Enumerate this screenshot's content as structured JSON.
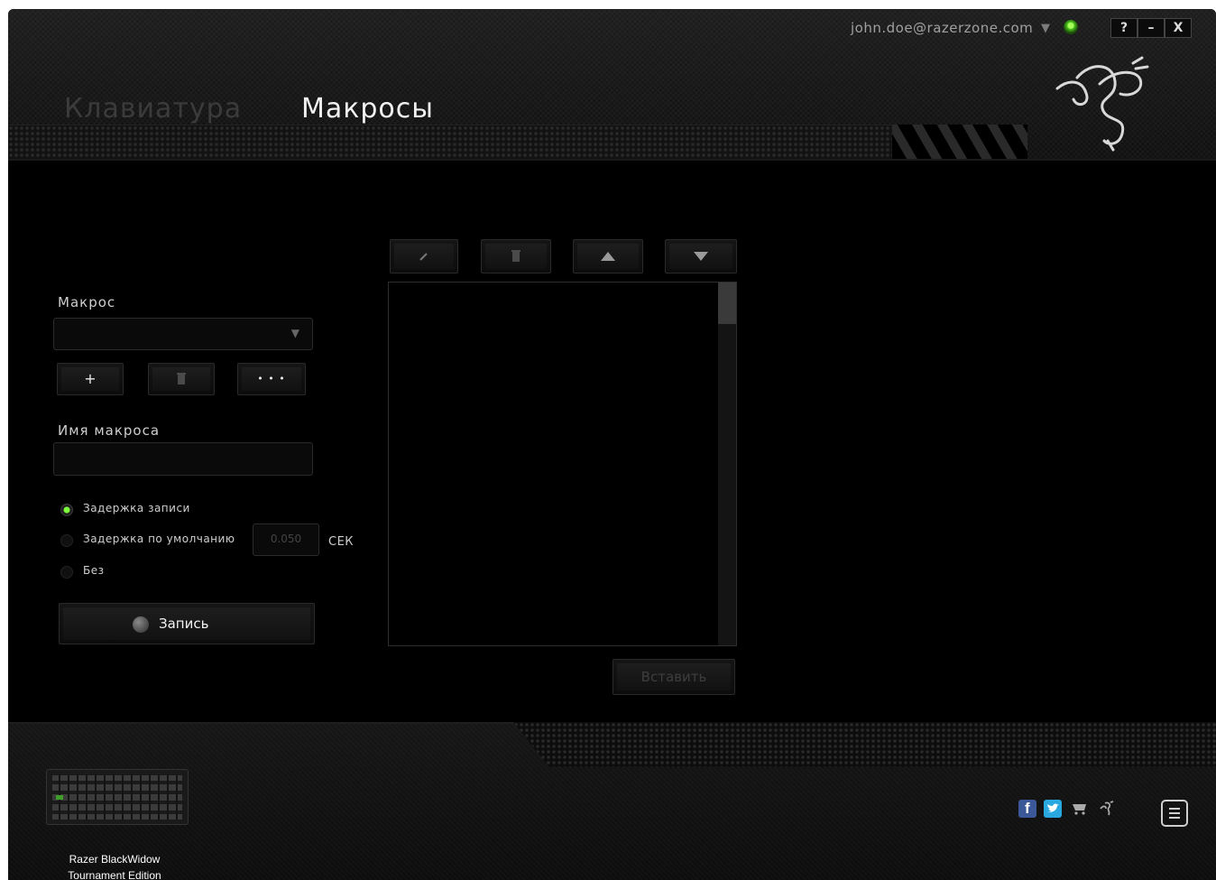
{
  "header": {
    "tabs": [
      {
        "label": "Клавиатура",
        "active": false
      },
      {
        "label": "Макросы",
        "active": true
      }
    ],
    "account_email": "john.doe@razerzone.com",
    "window_buttons": {
      "help": "?",
      "minimize": "–",
      "close": "X"
    }
  },
  "macro_panel": {
    "macro_label": "Макрос",
    "macro_select_value": "",
    "buttons": {
      "add": "+",
      "delete_icon": "trash-icon",
      "more": "• • •"
    },
    "name_label": "Имя макроса",
    "name_value": "",
    "delay_options": [
      {
        "label": "Задержка записи",
        "selected": true
      },
      {
        "label": "Задержка по умолчанию",
        "selected": false
      },
      {
        "label": "Без",
        "selected": false
      }
    ],
    "default_delay_value": "0.050",
    "delay_unit": "СЕК",
    "record_button": "Запись"
  },
  "editor": {
    "toolbar_icons": [
      "pencil-icon",
      "trash-icon",
      "arrow-up-icon",
      "arrow-down-icon"
    ],
    "insert_button": "Вставить"
  },
  "footer": {
    "device_name_line1": "Razer BlackWidow",
    "device_name_line2": "Tournament Edition",
    "social_icons": [
      "facebook-icon",
      "twitter-icon",
      "cart-icon",
      "razer-icon"
    ],
    "colors": {
      "facebook": "#3b5998",
      "twitter": "#2aa9e0",
      "accent": "#44d62c"
    }
  }
}
